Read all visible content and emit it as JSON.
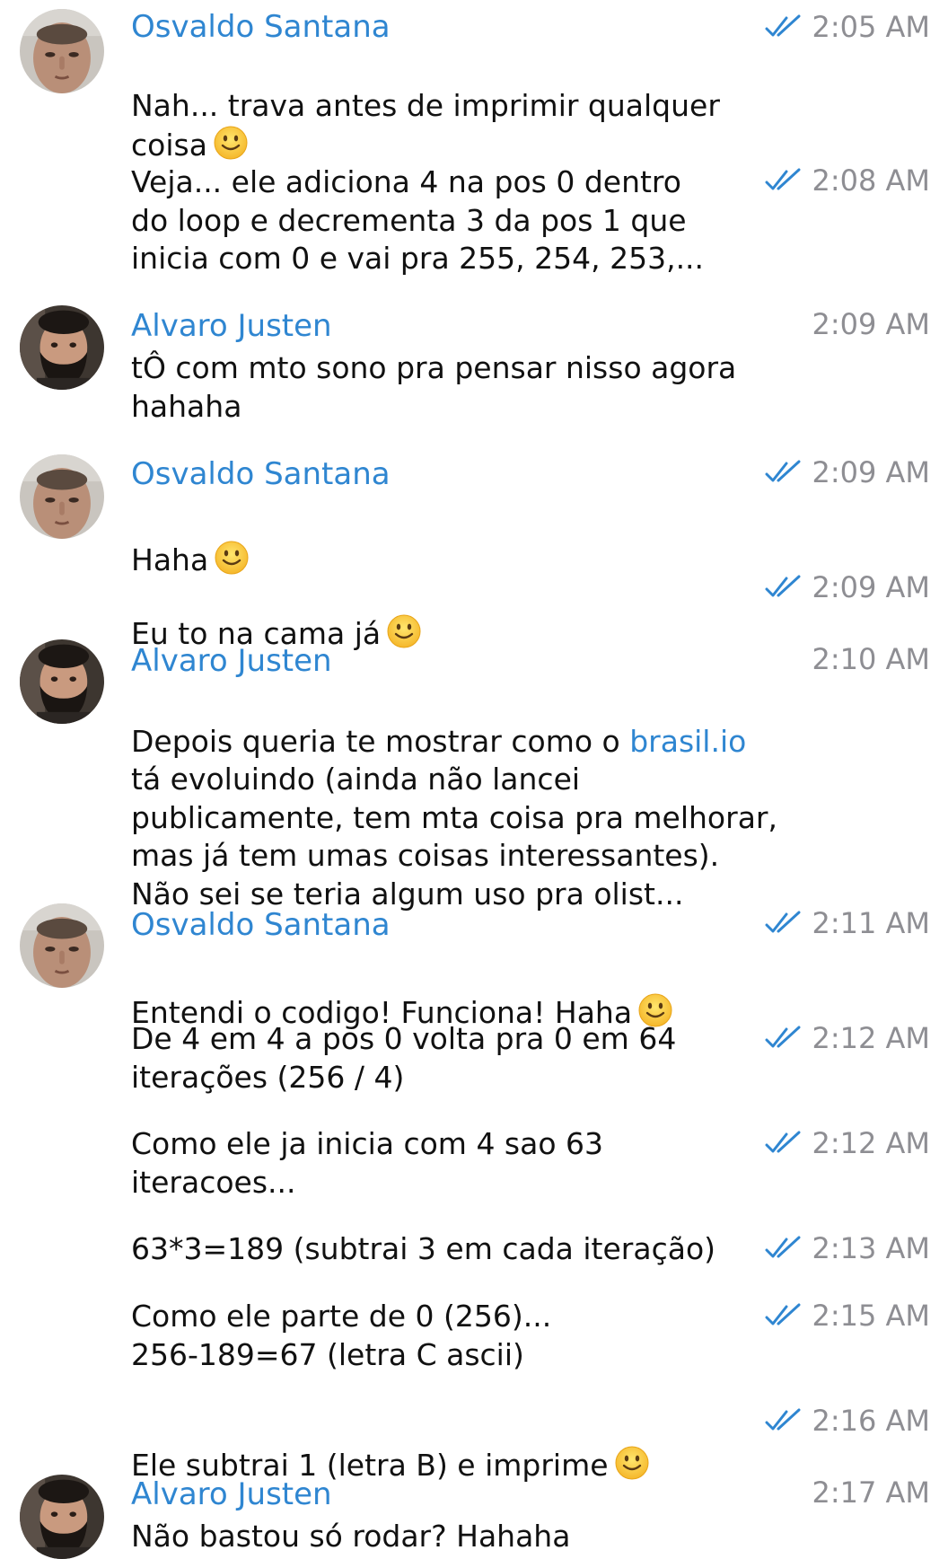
{
  "contacts": {
    "osvaldo": "Osvaldo Santana",
    "alvaro": "Alvaro Justen"
  },
  "messages": [
    {
      "time": "2:05 AM",
      "read": true,
      "text": "Nah... trava antes de imprimir qualquer\ncoisa",
      "emoji": "slight-smile"
    },
    {
      "time": "2:08 AM",
      "read": true,
      "text": "Veja... ele adiciona 4 na pos 0 dentro\ndo loop e decrementa 3 da pos 1 que\ninicia com 0 e vai pra 255, 254, 253,..."
    },
    {
      "time": "2:09 AM",
      "read": false,
      "text": "tÔ com mto sono pra pensar nisso agora\nhahaha"
    },
    {
      "time": "2:09 AM",
      "read": true,
      "text": "Haha",
      "emoji": "slight-smile"
    },
    {
      "time": "2:09 AM",
      "read": true,
      "text": "Eu to na cama já",
      "emoji": "slight-smile"
    },
    {
      "time": "2:10 AM",
      "read": false,
      "pre": "Depois queria te mostrar como o ",
      "link": "brasil.io",
      "text": "\ntá evoluindo (ainda não lancei\npublicamente, tem mta coisa pra melhorar,\nmas já tem umas coisas interessantes).\nNão sei se teria algum uso pra olist..."
    },
    {
      "time": "2:11 AM",
      "read": true,
      "text": "Entendi o codigo! Funciona! Haha",
      "emoji": "slight-smile"
    },
    {
      "time": "2:12 AM",
      "read": true,
      "text": "De 4 em 4 a pos 0 volta pra 0 em 64\niterações (256 / 4)"
    },
    {
      "time": "2:12 AM",
      "read": true,
      "text": "Como ele ja inicia com 4 sao 63\niteracoes..."
    },
    {
      "time": "2:13 AM",
      "read": true,
      "text": "63*3=189 (subtrai 3 em cada iteração)"
    },
    {
      "time": "2:15 AM",
      "read": true,
      "text": "Como ele parte de 0 (256)...\n256-189=67 (letra C ascii)"
    },
    {
      "time": "2:16 AM",
      "read": true,
      "text": "Ele subtrai 1 (letra B) e imprime",
      "emoji": "slight-smile"
    },
    {
      "time": "2:17 AM",
      "read": false,
      "text": "Não bastou só rodar? Hahaha"
    }
  ],
  "colors": {
    "sender_name": "#2f86d1",
    "link": "#2f86d1",
    "timestamp": "#8e8e93",
    "read_check": "#2f86d1"
  },
  "icons": {
    "read_receipt": "double-check-icon",
    "emoji": "slightly-smiling-face-icon"
  }
}
